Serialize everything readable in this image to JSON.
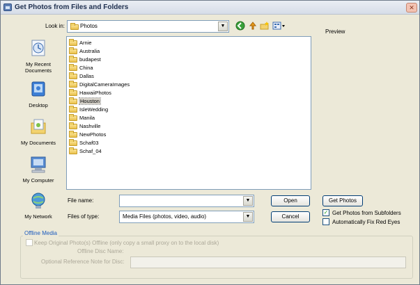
{
  "window": {
    "title": "Get Photos from Files and Folders"
  },
  "lookin": {
    "label": "Look in:",
    "value": "Photos"
  },
  "preview": {
    "label": "Preview"
  },
  "places": [
    {
      "label": "My Recent Documents",
      "icon": "recent-documents-icon"
    },
    {
      "label": "Desktop",
      "icon": "desktop-icon"
    },
    {
      "label": "My Documents",
      "icon": "my-documents-icon"
    },
    {
      "label": "My Computer",
      "icon": "my-computer-icon"
    },
    {
      "label": "My Network",
      "icon": "my-network-icon"
    }
  ],
  "files": [
    {
      "name": "Arnie"
    },
    {
      "name": "Australia"
    },
    {
      "name": "budapest"
    },
    {
      "name": "China"
    },
    {
      "name": "Dallas"
    },
    {
      "name": "DigitalCameraImages"
    },
    {
      "name": "HawaiiPhotos"
    },
    {
      "name": "Houston"
    },
    {
      "name": "IsleWedding"
    },
    {
      "name": "Manila"
    },
    {
      "name": "Nashville"
    },
    {
      "name": "NewPhotos"
    },
    {
      "name": "Schaf03"
    },
    {
      "name": "Schaf_04"
    }
  ],
  "selected_file": "Houston",
  "filename": {
    "label": "File name:",
    "value": ""
  },
  "filetype": {
    "label": "Files of type:",
    "value": "Media Files (photos, video, audio)"
  },
  "buttons": {
    "open": "Open",
    "cancel": "Cancel",
    "get_photos": "Get Photos"
  },
  "options": {
    "subfolders": {
      "label": "Get Photos from Subfolders",
      "checked": true
    },
    "red_eyes": {
      "label": "Automatically Fix Red Eyes",
      "checked": false
    }
  },
  "offline": {
    "group_label": "Offline Media",
    "keep_label": "Keep Original Photo(s) Offline (only copy a small proxy on to the local disk)",
    "disc_name_label": "Offline Disc Name:",
    "ref_note_label": "Optional Reference Note for Disc:",
    "keep_checked": false
  },
  "colors": {
    "title_text": "#1e2f4e",
    "group_title": "#1c5bbe",
    "disabled_text": "#aca899"
  }
}
